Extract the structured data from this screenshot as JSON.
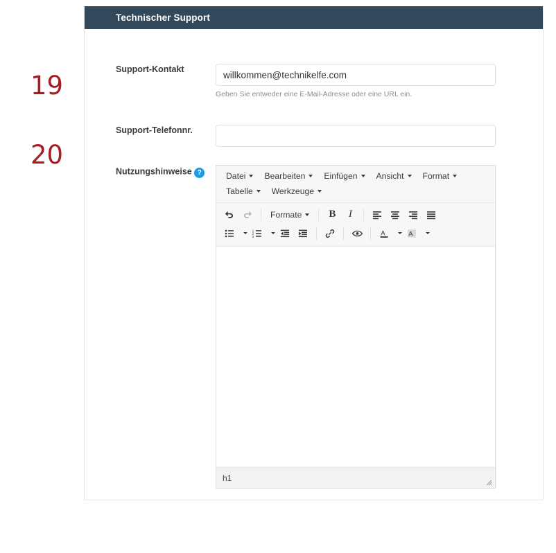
{
  "annotations": [
    {
      "id": "19",
      "label": "19"
    },
    {
      "id": "20",
      "label": "20"
    }
  ],
  "panel": {
    "header_title": "Technischer Support",
    "header_bg": "#32495c",
    "header_text_color": "#ffffff"
  },
  "form": {
    "support_contact": {
      "label": "Support-Kontakt",
      "value": "willkommen@technikelfe.com",
      "placeholder": "",
      "help_text": "Geben Sie entweder eine E-Mail-Adresse oder eine URL ein."
    },
    "support_phone": {
      "label": "Support-Telefonnr.",
      "value": "",
      "placeholder": ""
    },
    "usage_notes": {
      "label": "Nutzungshinweise",
      "help_icon": "help-circle-icon",
      "help_icon_glyph": "?",
      "help_icon_color": "#1f9bde"
    }
  },
  "editor": {
    "menubar": [
      {
        "label": "Datei",
        "icon": "chevron-down-icon"
      },
      {
        "label": "Bearbeiten",
        "icon": "chevron-down-icon"
      },
      {
        "label": "Einfügen",
        "icon": "chevron-down-icon"
      },
      {
        "label": "Ansicht",
        "icon": "chevron-down-icon"
      },
      {
        "label": "Format",
        "icon": "chevron-down-icon"
      },
      {
        "label": "Tabelle",
        "icon": "chevron-down-icon"
      },
      {
        "label": "Werkzeuge",
        "icon": "chevron-down-icon"
      }
    ],
    "toolbar_row1": [
      {
        "name": "undo-icon",
        "label": "",
        "state": "enabled"
      },
      {
        "name": "redo-icon",
        "label": "",
        "state": "disabled"
      },
      {
        "name": "formats-dropdown",
        "label": "Formate",
        "state": "enabled"
      },
      {
        "name": "bold-icon",
        "label": "B",
        "state": "enabled"
      },
      {
        "name": "italic-icon",
        "label": "I",
        "state": "enabled"
      },
      {
        "name": "align-left-icon",
        "label": "",
        "state": "enabled"
      },
      {
        "name": "align-center-icon",
        "label": "",
        "state": "enabled"
      },
      {
        "name": "align-right-icon",
        "label": "",
        "state": "enabled"
      },
      {
        "name": "align-justify-icon",
        "label": "",
        "state": "enabled"
      }
    ],
    "toolbar_row2": [
      {
        "name": "bullet-list-icon",
        "label": "",
        "state": "enabled"
      },
      {
        "name": "numbered-list-icon",
        "label": "",
        "state": "enabled"
      },
      {
        "name": "outdent-icon",
        "label": "",
        "state": "enabled"
      },
      {
        "name": "indent-icon",
        "label": "",
        "state": "enabled"
      },
      {
        "name": "link-icon",
        "label": "",
        "state": "enabled"
      },
      {
        "name": "preview-eye-icon",
        "label": "",
        "state": "enabled"
      },
      {
        "name": "text-color-icon",
        "label": "A",
        "state": "enabled"
      },
      {
        "name": "background-color-icon",
        "label": "A",
        "state": "enabled"
      }
    ],
    "content": "",
    "statusbar_path": "h1",
    "resize_handle": "resize-grip-icon"
  }
}
